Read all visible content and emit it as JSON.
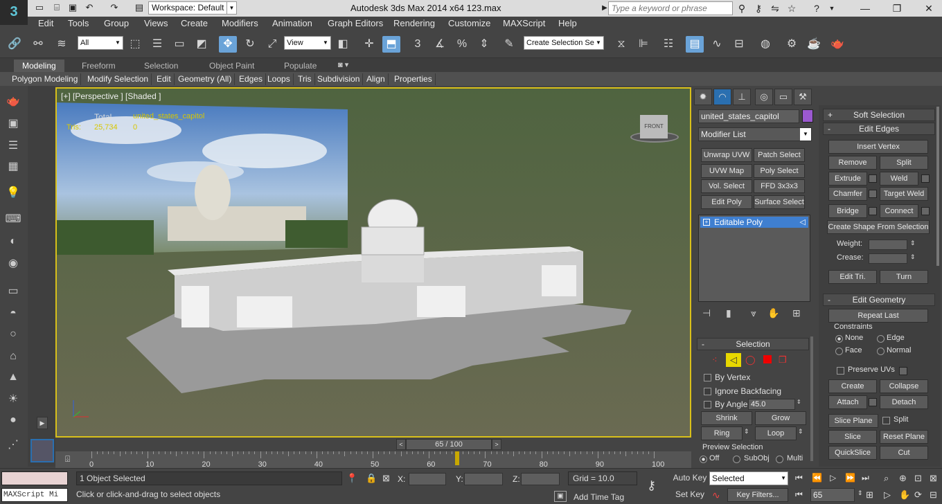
{
  "titlebar": {
    "workspace": "Workspace: Default",
    "app_title": "Autodesk 3ds Max  2014 x64      123.max",
    "search_placeholder": "Type a keyword or phrase"
  },
  "menu": [
    "Edit",
    "Tools",
    "Group",
    "Views",
    "Create",
    "Modifiers",
    "Animation",
    "Graph Editors",
    "Rendering",
    "Customize",
    "MAXScript",
    "Help"
  ],
  "toolbar": {
    "selection_filter": "All",
    "ref_coord": "View",
    "named_selection": "Create Selection Se",
    "snap_label": "3",
    "percent_label": "%"
  },
  "ribbon": {
    "tabs": [
      "Modeling",
      "Freeform",
      "Selection",
      "Object Paint",
      "Populate"
    ],
    "panels": [
      "Polygon Modeling",
      "Modify Selection",
      "Edit",
      "Geometry (All)",
      "Edges",
      "Loops",
      "Tris",
      "Subdivision",
      "Align",
      "Properties"
    ]
  },
  "viewport": {
    "label": "[+] [Perspective ] [Shaded ]",
    "stats_total_label": "Total",
    "stats_object": "united_states_capitol",
    "stats_tris_label": "Tris:",
    "stats_tris_total": "25,734",
    "stats_tris_object": "0",
    "viewcube_label": "FRONT"
  },
  "cmdpanel": {
    "object_name": "united_states_capitol",
    "object_color": "#9b59d0",
    "modifier_list": "Modifier List",
    "modifier_buttons": [
      "Unwrap UVW",
      "Patch Select",
      "UVW Map",
      "Poly Select",
      "Vol. Select",
      "FFD 3x3x3",
      "Edit Poly",
      "Surface Select"
    ],
    "stack_item": "Editable Poly",
    "selection": {
      "header": "Selection",
      "by_vertex": "By Vertex",
      "ignore_backfacing": "Ignore Backfacing",
      "by_angle": "By Angle:",
      "angle_value": "45.0",
      "shrink": "Shrink",
      "grow": "Grow",
      "ring": "Ring",
      "loop": "Loop",
      "preview_label": "Preview Selection",
      "preview_options": [
        "Off",
        "SubObj",
        "Multi"
      ]
    },
    "soft_selection": "Soft Selection",
    "edit_edges": {
      "header": "Edit Edges",
      "insert_vertex": "Insert Vertex",
      "remove": "Remove",
      "split": "Split",
      "extrude": "Extrude",
      "weld": "Weld",
      "chamfer": "Chamfer",
      "target_weld": "Target Weld",
      "bridge": "Bridge",
      "connect": "Connect",
      "create_shape": "Create Shape From Selection",
      "weight_label": "Weight:",
      "crease_label": "Crease:",
      "edit_tri": "Edit Tri.",
      "turn": "Turn"
    },
    "edit_geometry": {
      "header": "Edit Geometry",
      "repeat_last": "Repeat Last",
      "constraints": "Constraints",
      "constraint_opts": [
        "None",
        "Edge",
        "Face",
        "Normal"
      ],
      "preserve_uvs": "Preserve UVs",
      "create": "Create",
      "collapse": "Collapse",
      "attach": "Attach",
      "detach": "Detach",
      "slice_plane": "Slice Plane",
      "split": "Split",
      "slice": "Slice",
      "reset_plane": "Reset Plane",
      "quickslice": "QuickSlice",
      "cut": "Cut"
    }
  },
  "timeline": {
    "frame_display": "65 / 100",
    "current_frame": 65,
    "max_frame": 100,
    "ticks": [
      "0",
      "10",
      "20",
      "30",
      "40",
      "50",
      "60",
      "70",
      "80",
      "90",
      "100"
    ]
  },
  "status": {
    "maxscript": "MAXScript Mi",
    "objects_selected": "1 Object Selected",
    "prompt": "Click or click-and-drag to select objects",
    "x_label": "X:",
    "y_label": "Y:",
    "z_label": "Z:",
    "grid": "Grid = 10.0",
    "add_time_tag": "Add Time Tag",
    "auto_key": "Auto Key",
    "set_key": "Set Key",
    "key_mode": "Selected",
    "key_filters": "Key Filters...",
    "frame": "65"
  }
}
